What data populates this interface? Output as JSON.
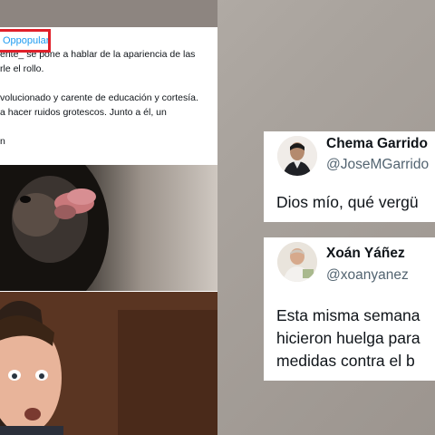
{
  "left_post": {
    "mention": "Oppopular",
    "lines": [
      "ente_ se pone a hablar de la apariencia de las",
      "rle el rollo.",
      "",
      "volucionado y carente de educación y cortesía.",
      "a hacer ruidos grotescos. Junto a él, un",
      "",
      "n"
    ]
  },
  "tweets": [
    {
      "name": "Chema Garrido",
      "handle": "@JoseMGarrido",
      "text": "Dios mío, qué vergü"
    },
    {
      "name": "Xoán Yáñez",
      "handle": "@xoanyanez",
      "text": "Esta misma semana\nhicieron huelga para\nmedidas contra el b"
    }
  ],
  "colors": {
    "highlight_border": "#e0202a",
    "link_blue": "#1d9bf0",
    "handle_grey": "#536471",
    "text_dark": "#0f1419"
  }
}
